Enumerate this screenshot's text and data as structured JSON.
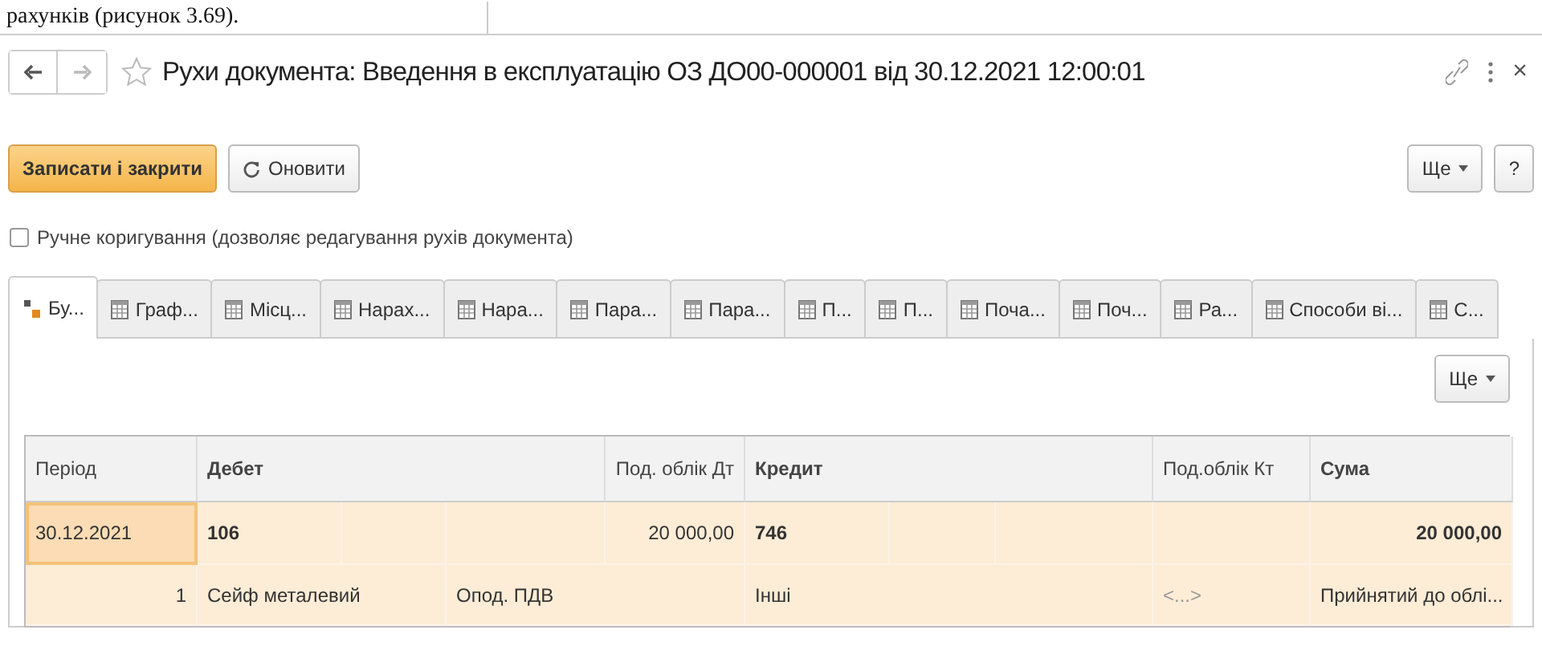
{
  "document_text": "рахунків (рисунок 3.69).",
  "window": {
    "title": "Рухи документа: Введення в експлуатацію ОЗ ДО00-000001 від 30.12.2021 12:00:01",
    "close": "×"
  },
  "toolbar": {
    "save": "Записати і закрити",
    "refresh": "Оновити",
    "more": "Ще",
    "help": "?"
  },
  "manual_edit": {
    "label": "Ручне коригування (дозволяє редагування рухів документа)",
    "checked": false
  },
  "tabs": [
    {
      "label": "Бу...",
      "kind": "accounting",
      "selected": true
    },
    {
      "label": "Граф...",
      "kind": "register",
      "selected": false
    },
    {
      "label": "Місц...",
      "kind": "register",
      "selected": false
    },
    {
      "label": "Нарах...",
      "kind": "register",
      "selected": false
    },
    {
      "label": "Нара...",
      "kind": "register",
      "selected": false
    },
    {
      "label": "Пара...",
      "kind": "register",
      "selected": false
    },
    {
      "label": "Пара...",
      "kind": "register",
      "selected": false
    },
    {
      "label": "П...",
      "kind": "register",
      "selected": false
    },
    {
      "label": "П...",
      "kind": "register",
      "selected": false
    },
    {
      "label": "Поча...",
      "kind": "register",
      "selected": false
    },
    {
      "label": "Поч...",
      "kind": "register",
      "selected": false
    },
    {
      "label": "Ра...",
      "kind": "register",
      "selected": false
    },
    {
      "label": "Способи ві...",
      "kind": "register",
      "selected": false
    },
    {
      "label": "С...",
      "kind": "register",
      "selected": false
    }
  ],
  "panel": {
    "more": "Ще"
  },
  "table": {
    "columns": [
      "Період",
      "Дебет",
      "Под. облік Дт",
      "Кредит",
      "Под.облік Кт",
      "Сума"
    ],
    "rows": [
      {
        "kind": "main",
        "selected": true,
        "period": "30.12.2021",
        "debit": "106",
        "amount_dt": "20 000,00",
        "credit": "746",
        "amount": "20 000,00"
      },
      {
        "kind": "detail",
        "selected": true,
        "line": "1",
        "debit_name": "Сейф металевий",
        "debit_tax": "Опод. ПДВ",
        "credit_name": "Інші",
        "credit_tax": "<...>",
        "status": "Прийнятий до облі..."
      }
    ]
  }
}
